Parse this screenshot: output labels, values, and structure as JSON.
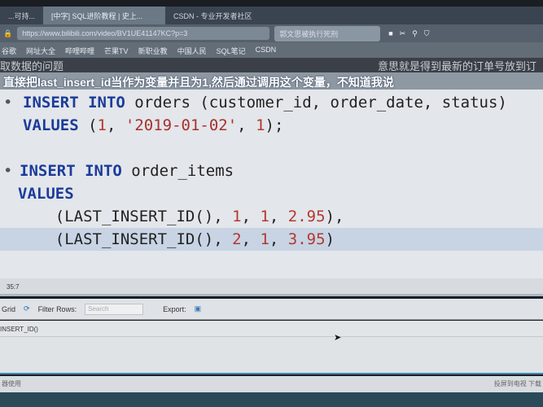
{
  "browser": {
    "tabs": [
      "...可持...",
      "[中字] SQL进阶教程 | 史上...",
      "CSDN - 专业开发者社区"
    ],
    "url": "https://www.bilibili.com/video/BV1UE41147KC?p=3",
    "search": "郭文思被执行死刑",
    "bookmarks": [
      "谷歌",
      "网址大全",
      "哔哩哔哩",
      "芒果TV",
      "新职业教",
      "中国人民",
      "SQL笔记",
      "CSDN"
    ]
  },
  "subtitles": {
    "line1_left": "取数据的问题",
    "line1_right": "意思就是得到最新的订单号放到订",
    "line2": "直接把last_insert_id当作为变量并且为1,然后通过调用这个变量，不知道我说"
  },
  "code": [
    [
      [
        "kw",
        "INSERT INTO"
      ],
      [
        "",
        "orders (customer_id, order_date, status)"
      ]
    ],
    [
      [
        "kw",
        "VALUES"
      ],
      [
        "",
        "("
      ],
      [
        "num",
        "1"
      ],
      [
        "",
        ", "
      ],
      [
        "str",
        "'2019-01-02'"
      ],
      [
        "",
        ", "
      ],
      [
        "num",
        "1"
      ],
      [
        "",
        ");"
      ]
    ],
    [
      [
        "kw",
        "INSERT INTO"
      ],
      [
        "",
        "order_items"
      ]
    ],
    [
      [
        "kw",
        "VALUES"
      ]
    ],
    [
      [
        "",
        "    (LAST_INSERT_ID(), "
      ],
      [
        "num",
        "1"
      ],
      [
        "",
        ", "
      ],
      [
        "num",
        "1"
      ],
      [
        "",
        ", "
      ],
      [
        "num",
        "2.95"
      ],
      [
        "",
        "),"
      ]
    ],
    [
      [
        "",
        "    (LAST_INSERT_ID(), "
      ],
      [
        "num",
        "2"
      ],
      [
        "",
        ", "
      ],
      [
        "num",
        "1"
      ],
      [
        "",
        ", "
      ],
      [
        "num",
        "3.95"
      ],
      [
        "",
        ")"
      ]
    ]
  ],
  "status": {
    "position": "35:7"
  },
  "results": {
    "grid": "Grid",
    "filter_label": "Filter Rows:",
    "search_placeholder": "Search",
    "export_label": "Export:",
    "column": "INSERT_ID()"
  },
  "bottom": {
    "left": "器使用",
    "right": "投屏到电视   下载"
  }
}
